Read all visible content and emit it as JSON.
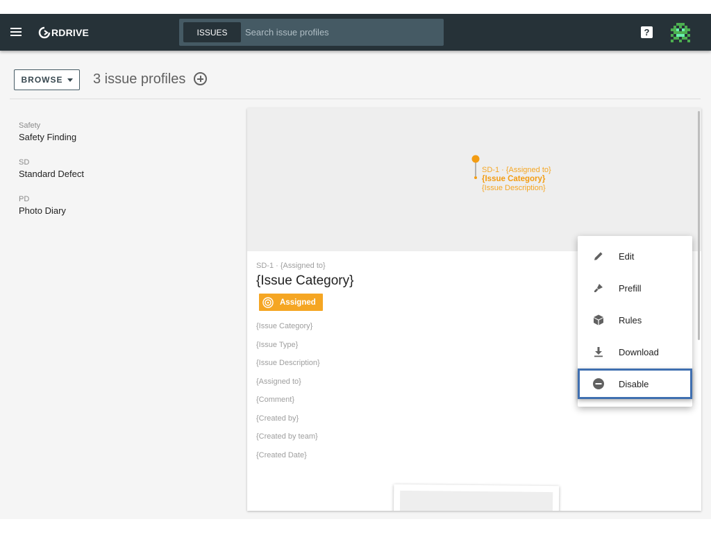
{
  "app": {
    "logo_text": "RDRIVE"
  },
  "search": {
    "chip_label": "ISSUES",
    "placeholder": "Search issue profiles",
    "value": ""
  },
  "header": {
    "browse_label": "BROWSE",
    "title": "3 issue profiles"
  },
  "profiles": [
    {
      "code": "Safety",
      "name": "Safety Finding"
    },
    {
      "code": "SD",
      "name": "Standard Defect"
    },
    {
      "code": "PD",
      "name": "Photo Diary"
    }
  ],
  "preview": {
    "pin_line1": "SD-1 · {Assigned to}",
    "pin_line2": "{Issue Category}",
    "pin_line3": "{Issue Description}"
  },
  "card": {
    "subtitle": "SD-1 · {Assigned to}",
    "title": "{Issue Category}",
    "status": "Assigned",
    "fields": [
      "{Issue Category}",
      "{Issue Type}",
      "{Issue Description}",
      "{Assigned to}",
      "{Comment}",
      "{Created by}",
      "{Created by team}",
      "{Created Date}"
    ]
  },
  "menu": {
    "items": [
      {
        "label": "Edit",
        "icon": "pencil-icon"
      },
      {
        "label": "Prefill",
        "icon": "brush-icon"
      },
      {
        "label": "Rules",
        "icon": "cube-icon"
      },
      {
        "label": "Download",
        "icon": "download-icon"
      },
      {
        "label": "Disable",
        "icon": "minus-circle-icon"
      }
    ]
  },
  "colors": {
    "topbar": "#263238",
    "accent_orange": "#f5a623",
    "highlight_blue": "#3f6fb0"
  }
}
